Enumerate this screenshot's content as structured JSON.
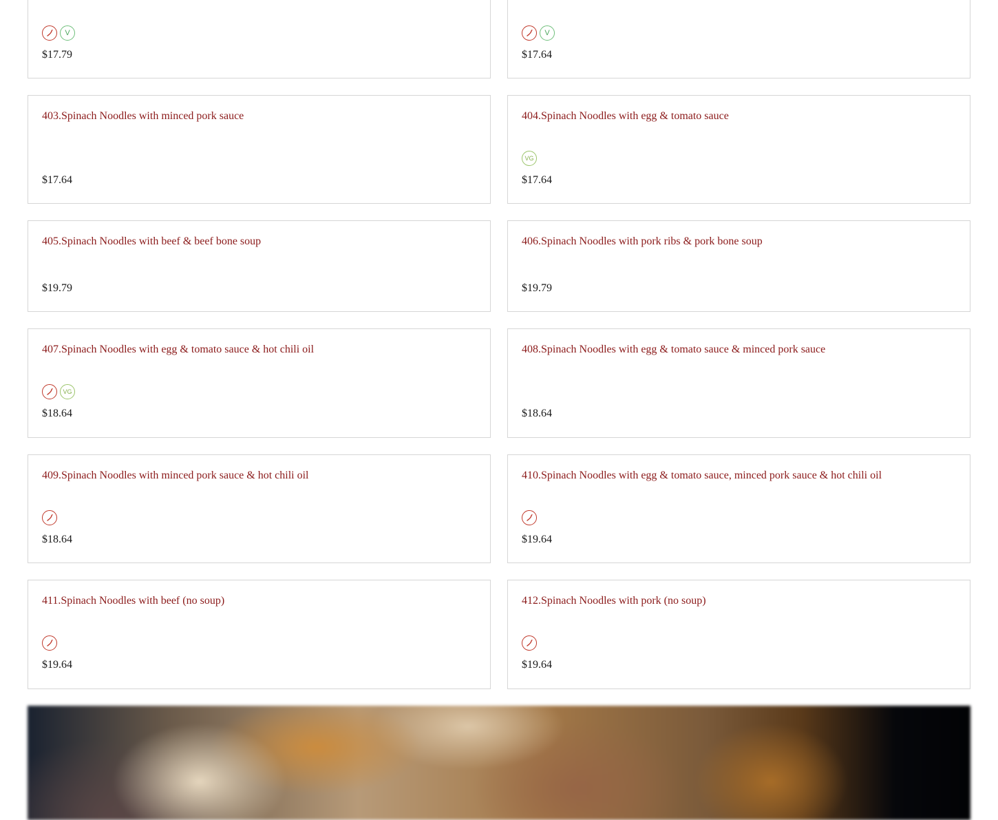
{
  "menu": {
    "items": [
      {
        "title": "",
        "badges": [
          "spicy",
          "veg"
        ],
        "price": "$17.79"
      },
      {
        "title": "",
        "badges": [
          "spicy",
          "veg"
        ],
        "price": "$17.64"
      },
      {
        "title": "403.Spinach Noodles with minced pork sauce",
        "badges": [],
        "price": "$17.64"
      },
      {
        "title": "404.Spinach Noodles with egg & tomato sauce",
        "badges": [
          "vegan"
        ],
        "price": "$17.64"
      },
      {
        "title": "405.Spinach Noodles with beef & beef bone soup",
        "badges": [],
        "price": "$19.79"
      },
      {
        "title": "406.Spinach Noodles with pork ribs & pork bone soup",
        "badges": [],
        "price": "$19.79"
      },
      {
        "title": "407.Spinach Noodles with egg & tomato sauce & hot chili oil",
        "badges": [
          "spicy",
          "vegan"
        ],
        "price": "$18.64"
      },
      {
        "title": "408.Spinach Noodles with egg & tomato sauce & minced pork sauce",
        "badges": [],
        "price": "$18.64"
      },
      {
        "title": "409.Spinach Noodles with minced pork sauce & hot chili oil",
        "badges": [
          "spicy"
        ],
        "price": "$18.64"
      },
      {
        "title": "410.Spinach Noodles with egg & tomato sauce, minced pork sauce & hot chili oil",
        "badges": [
          "spicy"
        ],
        "price": "$19.64"
      },
      {
        "title": "411.Spinach Noodles with beef (no soup)",
        "badges": [
          "spicy"
        ],
        "price": "$19.64"
      },
      {
        "title": "412.Spinach Noodles with pork (no soup)",
        "badges": [
          "spicy"
        ],
        "price": "$19.64"
      }
    ]
  },
  "badge_labels": {
    "veg": "V",
    "vegan": "VG"
  },
  "colors": {
    "title": "#8b1a1a",
    "spicy": "#c0392b",
    "veg": "#4fa860",
    "vegan": "#86b04f",
    "border": "#d6d6d6"
  }
}
